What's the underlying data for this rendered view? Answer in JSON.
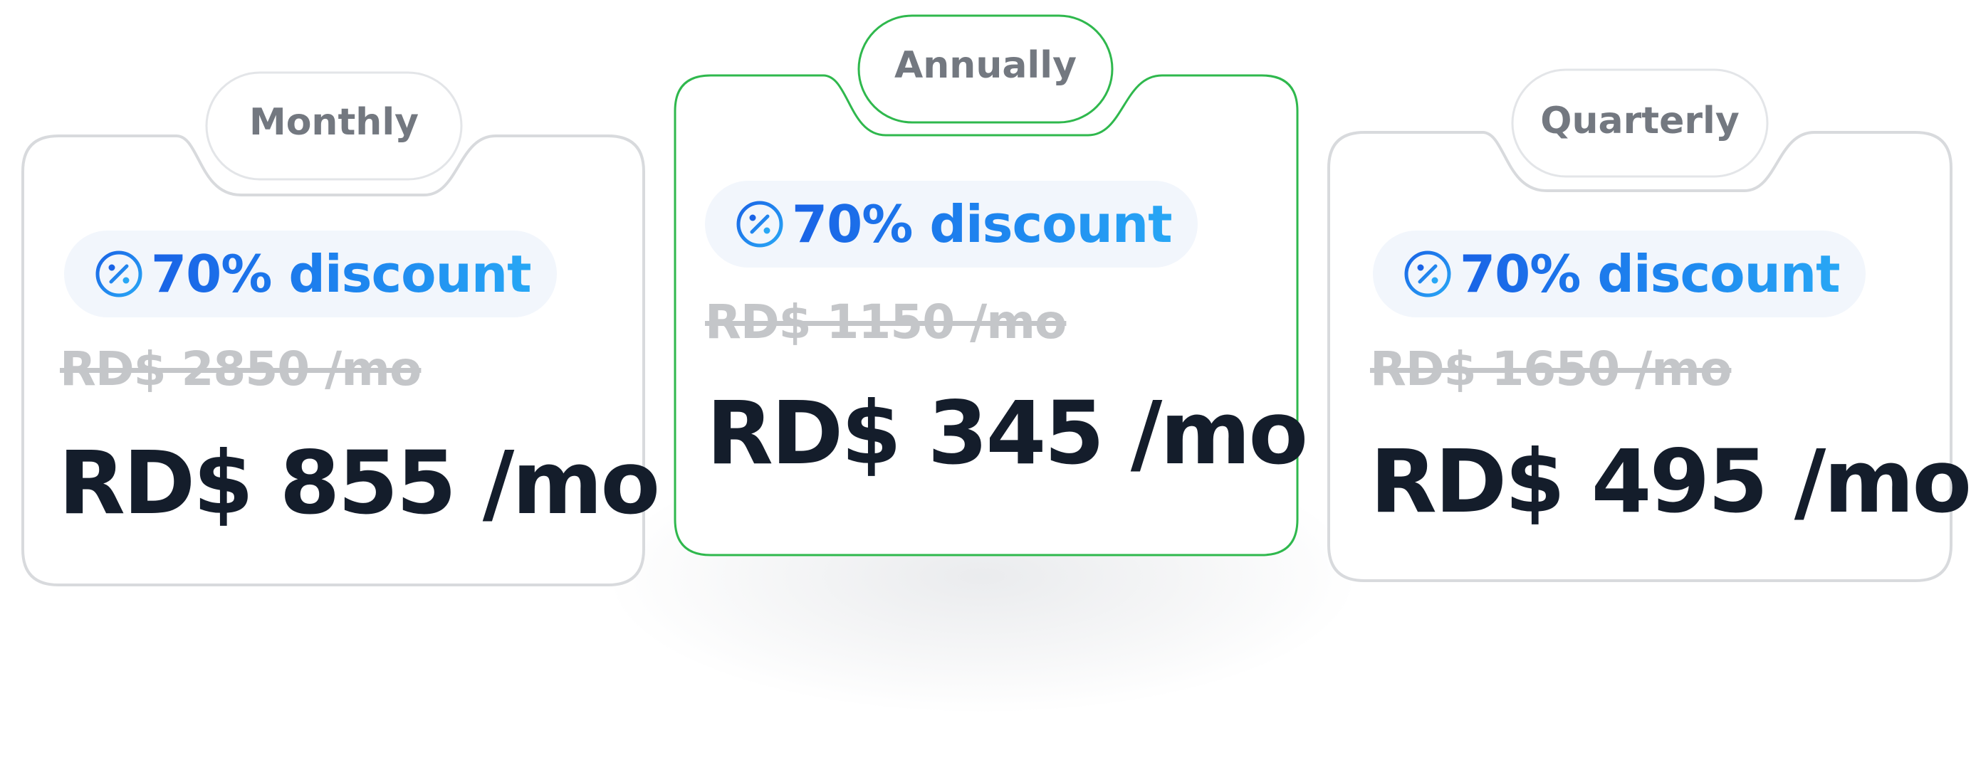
{
  "plans": [
    {
      "tab_label": "Monthly",
      "discount_label": "70% discount",
      "discount_icon": "percent-badge-icon",
      "original_price": "RD$ 2850 /mo",
      "price": "RD$ 855 /mo",
      "selected": false
    },
    {
      "tab_label": "Annually",
      "discount_label": "70% discount",
      "discount_icon": "percent-badge-icon",
      "original_price": "RD$ 1150 /mo",
      "price": "RD$ 345 /mo",
      "selected": true
    },
    {
      "tab_label": "Quarterly",
      "discount_label": "70% discount",
      "discount_icon": "percent-badge-icon",
      "original_price": "RD$ 1650 /mo",
      "price": "RD$ 495 /mo",
      "selected": false
    }
  ],
  "colors": {
    "selected_border": "#2fb84d",
    "card_border": "#d8dadd",
    "badge_background": "#f2f6fc",
    "accent_blue": "#1f7ae8",
    "price_text": "#141d2b",
    "tab_text": "#737880",
    "strikethrough_text": "#c4c6c9"
  }
}
